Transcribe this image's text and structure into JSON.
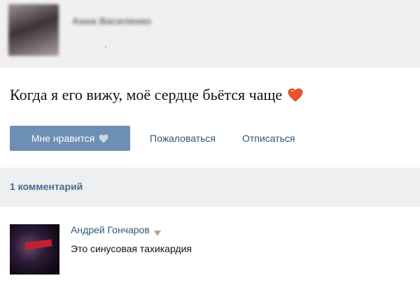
{
  "post": {
    "author": "Анна Василенко",
    "text": "Когда я его вижу, моё сердце бьётся чаще",
    "emoji": "heart-icon"
  },
  "actions": {
    "like_label": "Мне нравится",
    "report_label": "Пожаловаться",
    "unsubscribe_label": "Отписаться"
  },
  "comments": {
    "count_label": "1 комментарий",
    "items": [
      {
        "author": "Андрей Гончаров",
        "text": "Это синусовая тахикардия"
      }
    ]
  },
  "colors": {
    "accent": "#6d8fb3",
    "link": "#2b587a",
    "heart": "#e8542a"
  }
}
